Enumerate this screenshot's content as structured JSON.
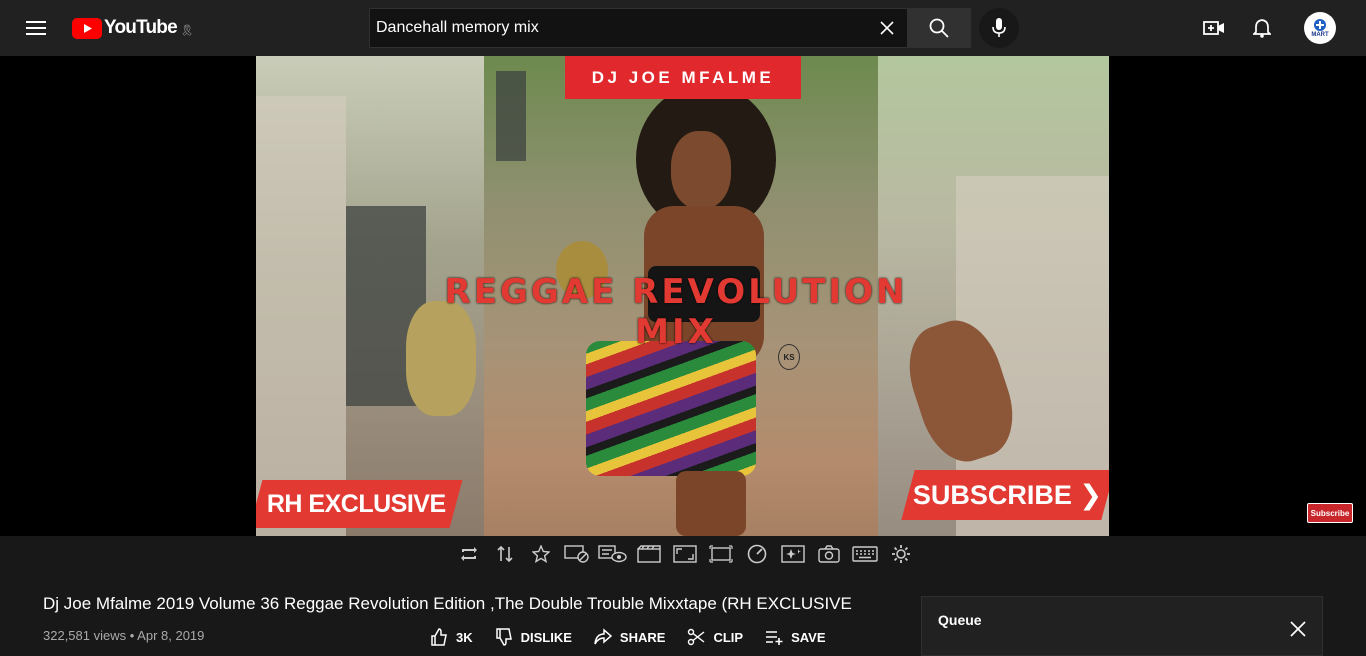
{
  "header": {
    "logo_text": "YouTube",
    "logo_ribbon": "🎗",
    "search_value": "Dancehall memory mix",
    "search_placeholder": "Search",
    "avatar_text": "MART"
  },
  "thumbnail": {
    "dj_banner": "DJ JOE MFALME",
    "mix_title": "REGGAE REVOLUTION MIX",
    "rh_badge": "RH EXCLUSIVE",
    "subscribe_badge": "SUBSCRIBE ❯",
    "logo_text": "KS",
    "watermark": "Subscribe"
  },
  "extension_toolbar": {
    "icons": [
      "repeat-icon",
      "sort-icon",
      "star-icon",
      "ad-block-icon",
      "view-count-icon",
      "clapper-icon",
      "aspect-ratio-icon",
      "screen-icon",
      "speedometer-icon",
      "sparkle-icon",
      "camera-icon",
      "keyboard-icon",
      "settings-icon"
    ]
  },
  "video": {
    "title": "Dj Joe Mfalme 2019 Volume 36 Reggae Revolution Edition ,The Double Trouble Mixxtape (RH EXCLUSIVE",
    "views_date": "322,581 views • Apr 8, 2019",
    "likes": "3K",
    "dislike_label": "DISLIKE",
    "share_label": "SHARE",
    "clip_label": "CLIP",
    "save_label": "SAVE"
  },
  "queue": {
    "title": "Queue"
  },
  "colors": {
    "accent_red": "#e23a33",
    "youtube_red": "#ff0000",
    "background": "#181818",
    "topbar": "#212121"
  }
}
